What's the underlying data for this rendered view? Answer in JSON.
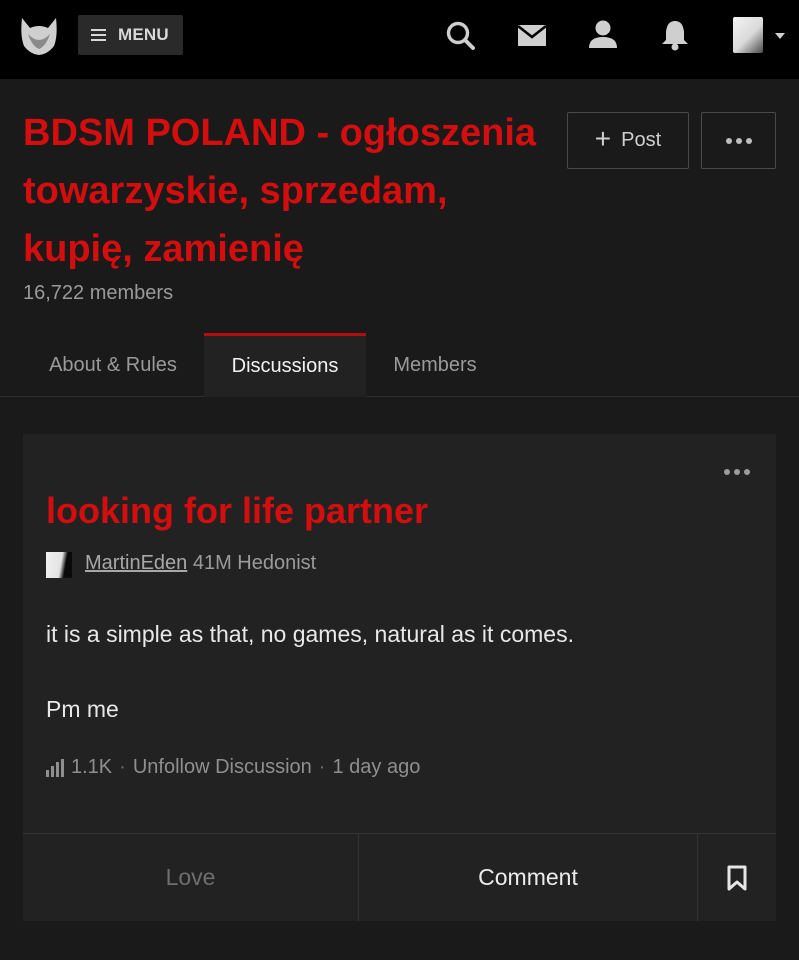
{
  "topbar": {
    "menu_label": "MENU",
    "icons": [
      "logo-icon",
      "search-icon",
      "mail-icon",
      "user-icon",
      "bell-icon",
      "avatar",
      "caret-down-icon"
    ]
  },
  "group": {
    "title": "BDSM POLAND - ogłoszenia towarzyskie, sprzedam, kupię, zamienię",
    "members": "16,722 members",
    "post_label": "Post"
  },
  "tabs": [
    {
      "label": "About & Rules",
      "active": false
    },
    {
      "label": "Discussions",
      "active": true
    },
    {
      "label": "Members",
      "active": false
    }
  ],
  "discussion": {
    "title": "looking for life partner",
    "author": "MartinEden",
    "author_info": "41M Hedonist",
    "body": [
      "it is a simple as that, no games, natural as it comes.",
      "Pm me"
    ],
    "views": "1.1K",
    "follow_label": "Unfollow Discussion",
    "time": "1 day ago",
    "love_label": "Love",
    "comment_label": "Comment"
  },
  "colors": {
    "accent": "#d40e0e",
    "background": "#1a1a1a",
    "topbar": "#000000",
    "card": "#222222"
  }
}
